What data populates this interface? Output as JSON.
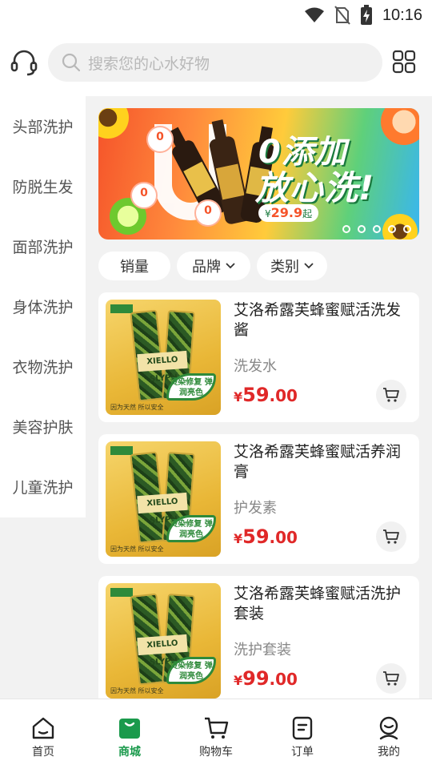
{
  "status_bar": {
    "time": "10:16"
  },
  "header": {
    "search_placeholder": "搜索您的心水好物",
    "icons": [
      "headset-icon",
      "search-icon",
      "grid-icon"
    ]
  },
  "sidebar": {
    "categories": [
      "头部洗护",
      "防脱生发",
      "面部洗护",
      "身体洗护",
      "衣物洗护",
      "美容护肤",
      "儿童洗护"
    ]
  },
  "banner": {
    "headline_line1": "0添加",
    "headline_line2": "放心洗!",
    "badges": [
      "0",
      "0",
      "0"
    ],
    "promo_price_prefix": "¥",
    "promo_price": "29.9",
    "promo_suffix": "起",
    "slide_count": 5
  },
  "filters": [
    {
      "label": "销量",
      "has_dropdown": false
    },
    {
      "label": "品牌",
      "has_dropdown": true
    },
    {
      "label": "类别",
      "has_dropdown": true
    }
  ],
  "products": [
    {
      "name": "艾洛希露芙蜂蜜赋活洗发酱",
      "category": "洗发水",
      "currency": "¥",
      "price_int": "59",
      "price_dec": ".00",
      "image_label": "XIELLO SLYPH",
      "image_leaf": "烫染修复 弹润亮色",
      "image_foot": "因为天然 所以安全"
    },
    {
      "name": "艾洛希露芙蜂蜜赋活养润膏",
      "category": "护发素",
      "currency": "¥",
      "price_int": "59",
      "price_dec": ".00",
      "image_label": "XIELLO SLYPH",
      "image_leaf": "烫染修复 弹润亮色",
      "image_foot": "因为天然 所以安全"
    },
    {
      "name": "艾洛希露芙蜂蜜赋活洗护套装",
      "category": "洗护套装",
      "currency": "¥",
      "price_int": "99",
      "price_dec": ".00",
      "image_label": "XIELLO SLYPH",
      "image_leaf": "烫染修复 弹润亮色",
      "image_foot": "因为天然 所以安全"
    }
  ],
  "bottom_nav": [
    {
      "label": "首页",
      "icon": "home-icon",
      "active": false
    },
    {
      "label": "商城",
      "icon": "shop-bag-icon",
      "active": true
    },
    {
      "label": "购物车",
      "icon": "cart-icon",
      "active": false
    },
    {
      "label": "订单",
      "icon": "order-icon",
      "active": false
    },
    {
      "label": "我的",
      "icon": "profile-icon",
      "active": false
    }
  ],
  "colors": {
    "accent": "#1a9a4c",
    "price": "#e02828",
    "background": "#f2f2f2"
  }
}
